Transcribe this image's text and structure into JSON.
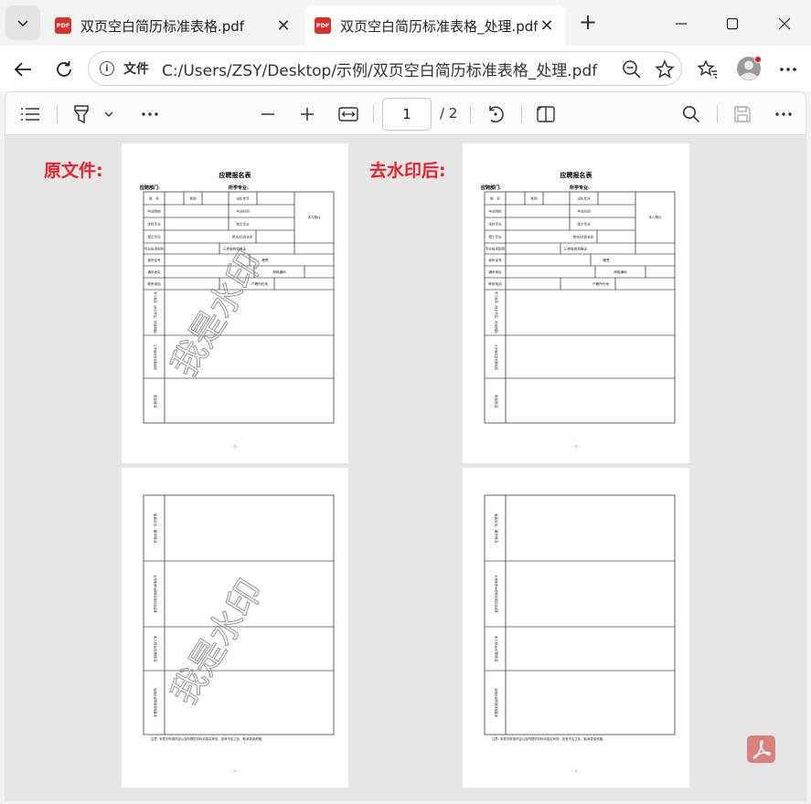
{
  "tabs": [
    {
      "label": "双页空白简历标准表格.pdf",
      "favicon": "PDF",
      "active": false
    },
    {
      "label": "双页空白简历标准表格_处理.pdf",
      "favicon": "PDF",
      "active": true
    }
  ],
  "address": {
    "scheme_label": "文件",
    "url": "C:/Users/ZSY/Desktop/示例/双页空白简历标准表格_处理.pdf"
  },
  "pdf_toolbar": {
    "current_page": "1",
    "total_pages": "/ 2"
  },
  "labels": {
    "original": "原文件:",
    "processed": "去水印后:"
  },
  "watermark": "我是水印",
  "document": {
    "title": "应聘报名表",
    "dept": "应聘部门:",
    "major": "所学专业:",
    "page1_footer": "- 1 -",
    "page2_footer": "- 2 -",
    "page2_note": "注意: 本表中所填内容以及所提供材料均真实有效，如有不实之处，取消录用资格。",
    "fields": {
      "name": "姓　名",
      "gender": "性别",
      "birth": "出生年月",
      "photo": "本人照片",
      "school": "毕业院校",
      "grad_time": "毕业时间",
      "bachelor": "本科专业",
      "master": "硕士专业",
      "phd": "博士专业",
      "pol": "党派/社会关系",
      "title_rank": "专业技术职务",
      "cert": "已考取的资格证",
      "id_no": "身份证号",
      "origin": "籍贯",
      "address": "通讯地址",
      "postcode": "邮政编码",
      "phone": "联系电话",
      "hukou": "户籍所在地",
      "edu_hist": "学习经历（自大学起，时间倒叙）",
      "work_hist": "工作或社会实践经历",
      "awards": "奖惩情况",
      "papers": "发表论文、著作情况",
      "projects": "主持或参与的科研项目及成果",
      "strengths": "本人特长优势情况",
      "others": "其他应说明事项或要求"
    }
  },
  "colors": {
    "label_red": "#e8212b",
    "pdf_red": "#d9302c",
    "viewer_bg": "#e6e6e6",
    "watermark_gray": "#9a9a9a"
  }
}
